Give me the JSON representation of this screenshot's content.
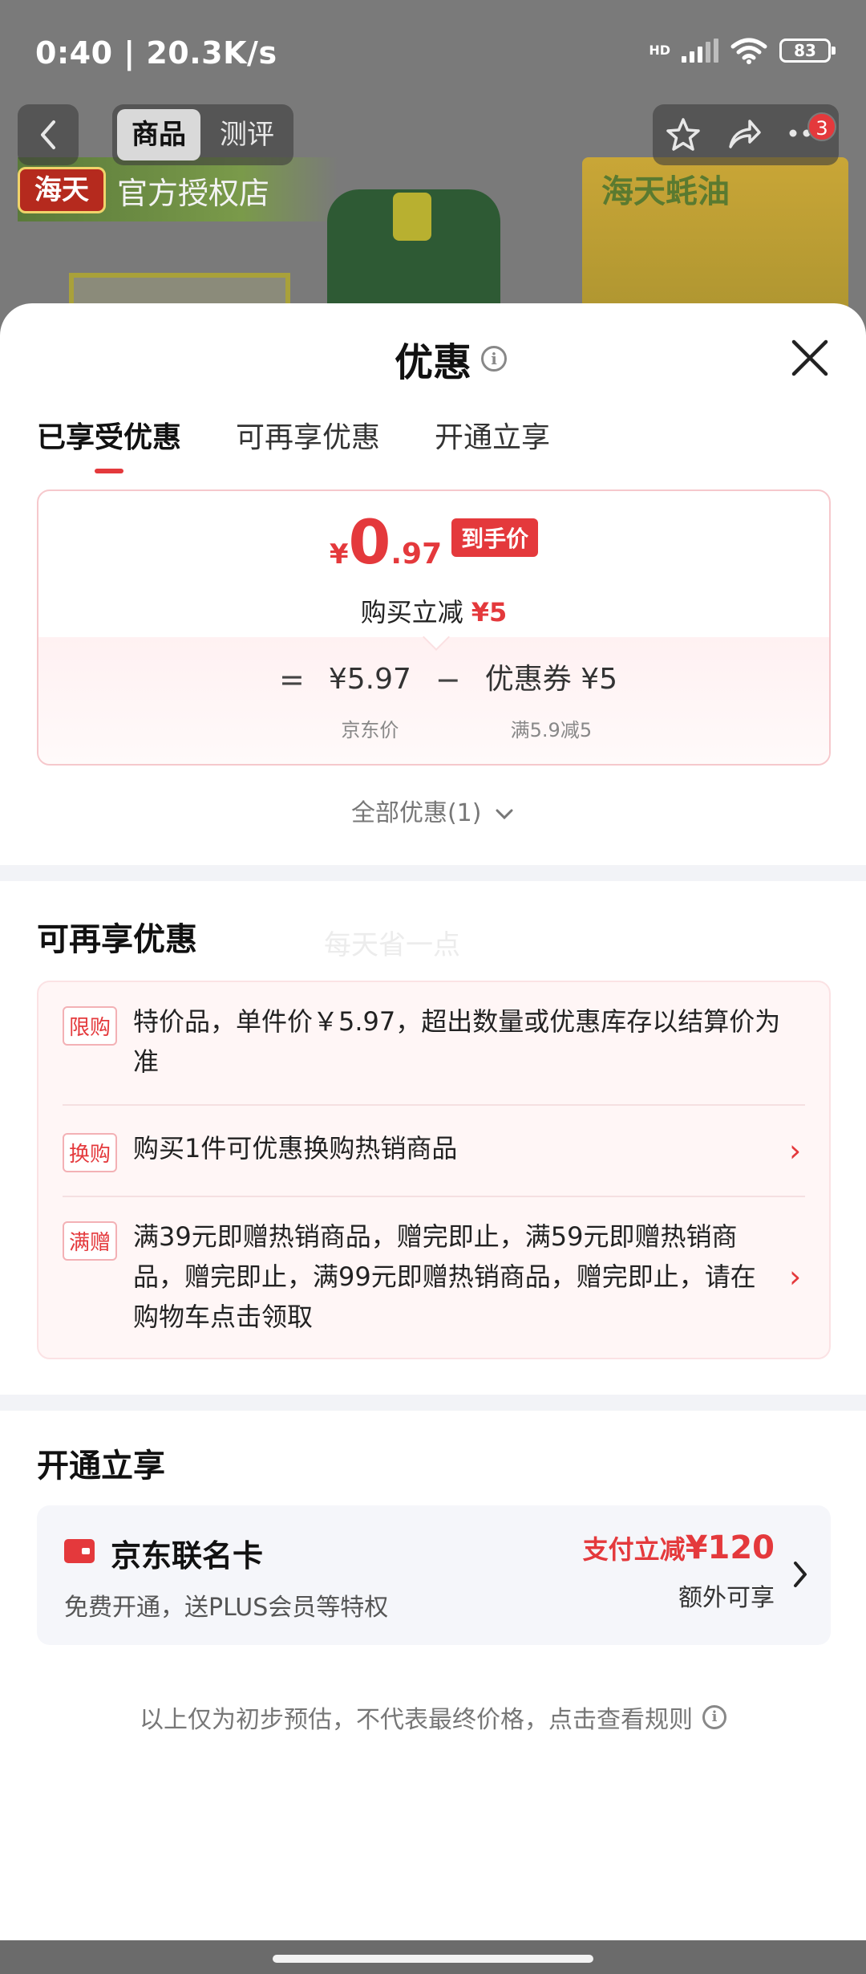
{
  "status_bar": {
    "time": "0:40 | 20.3K/s",
    "network_label": "HD",
    "battery": "83"
  },
  "header": {
    "tabs": [
      {
        "label": "商品",
        "active": true
      },
      {
        "label": "测评",
        "active": false
      }
    ],
    "notification_count": "3"
  },
  "background": {
    "store_logo": "海天",
    "store_name": "官方授权店",
    "product_banner": "海天蚝油"
  },
  "sheet": {
    "title": "优惠",
    "tabs": [
      {
        "label": "已享受优惠",
        "active": true
      },
      {
        "label": "可再享优惠",
        "active": false
      },
      {
        "label": "开通立享",
        "active": false
      }
    ],
    "price": {
      "currency": "¥",
      "integer": "0",
      "decimal": ".97",
      "tag": "到手价",
      "discount_label": "购买立减",
      "discount_value": "¥5",
      "equals": "=",
      "minus": "−",
      "base_value": "¥5.97",
      "base_label": "京东价",
      "coupon_value": "优惠券 ¥5",
      "coupon_label": "满5.9减5"
    },
    "all_offers": "全部优惠(1)",
    "more_section": {
      "title": "可再享优惠",
      "watermark": "每天省一点",
      "items": [
        {
          "tag": "限购",
          "text": "特价品，单件价￥5.97，超出数量或优惠库存以结算价为准",
          "arrow": ""
        },
        {
          "tag": "换购",
          "text": "购买1件可优惠换购热销商品",
          "arrow": "›"
        },
        {
          "tag": "满赠",
          "text": "满39元即赠热销商品，赠完即止，满59元即赠热销商品，赠完即止，满99元即赠热销商品，赠完即止，请在购物车点击领取",
          "arrow": "›"
        }
      ]
    },
    "open_section": {
      "title": "开通立享",
      "card_name": "京东联名卡",
      "card_desc": "免费开通，送PLUS会员等特权",
      "save_prefix": "支付立减",
      "save_amount": "¥120",
      "extra": "额外可享"
    },
    "footer_note": "以上仅为初步预估，不代表最终价格，点击查看规则"
  },
  "colors": {
    "accent": "#e4393c",
    "sheet_bg": "#ffffff",
    "divider": "#f2f3f7"
  }
}
